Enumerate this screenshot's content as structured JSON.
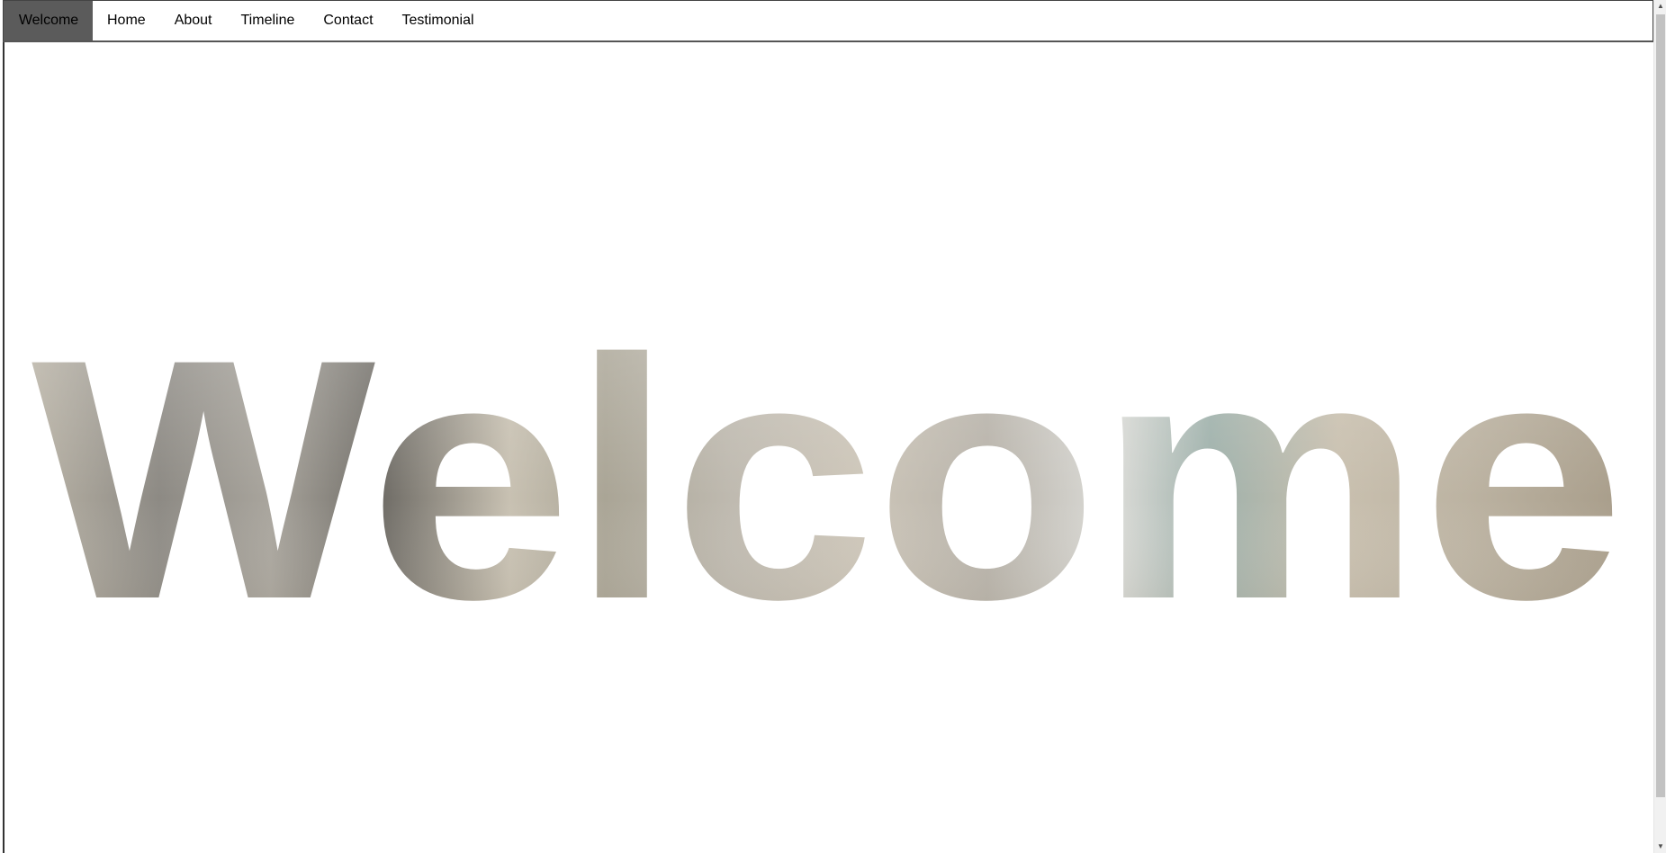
{
  "nav": {
    "items": [
      {
        "label": "Welcome",
        "active": true
      },
      {
        "label": "Home",
        "active": false
      },
      {
        "label": "About",
        "active": false
      },
      {
        "label": "Timeline",
        "active": false
      },
      {
        "label": "Contact",
        "active": false
      },
      {
        "label": "Testimonial",
        "active": false
      }
    ]
  },
  "hero": {
    "title": "Welcome"
  },
  "colors": {
    "active_nav_bg": "#5b5b5b",
    "text_fill_light": "#d9d3c6",
    "text_fill_dark": "#8f8a80"
  },
  "icons": {
    "scroll_up": "triangle-up-icon",
    "scroll_down": "triangle-down-icon"
  }
}
